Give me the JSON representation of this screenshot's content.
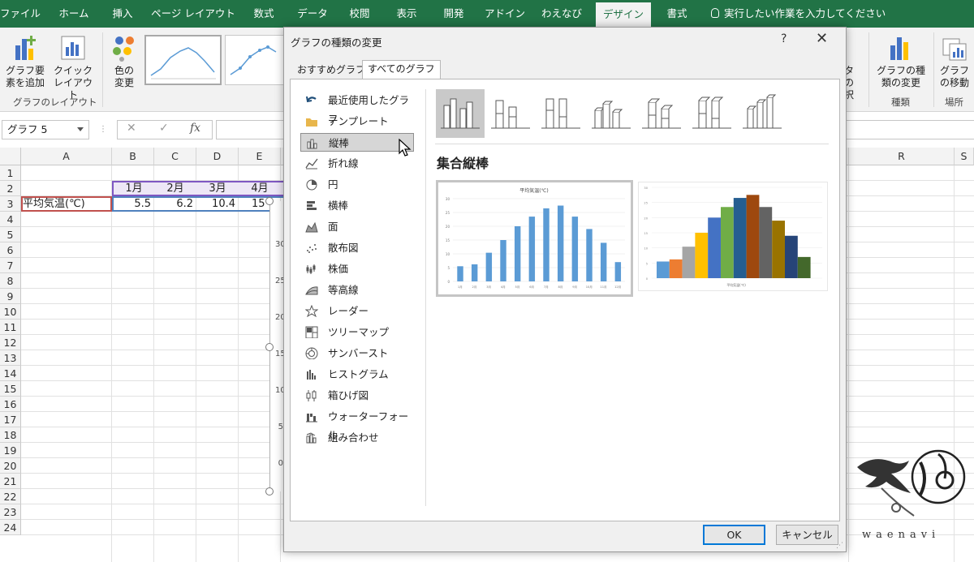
{
  "ribbon": {
    "tabs": [
      "ファイル",
      "ホーム",
      "挿入",
      "ページ レイアウト",
      "数式",
      "データ",
      "校閲",
      "表示",
      "開発",
      "アドイン",
      "わえなび",
      "デザイン",
      "書式"
    ],
    "active_tab": "デザイン",
    "tell_me": "実行したい作業を入力してください",
    "buttons": {
      "add_element": "グラフ要素を追加",
      "quick_layout": "クイックレイアウト",
      "change_color": "色の変更",
      "select_data_partial": "タの択",
      "change_type": "グラフの種類の変更",
      "move_chart": "グラフの移動"
    },
    "group_labels": {
      "layout": "グラフのレイアウト",
      "type": "種類",
      "location": "場所"
    }
  },
  "formula_bar": {
    "name_box": "グラフ 5",
    "fx": "fx"
  },
  "sheet": {
    "columns": [
      "A",
      "B",
      "C",
      "D",
      "E",
      "R",
      "S"
    ],
    "rows": [
      "1",
      "2",
      "3",
      "4",
      "5",
      "6",
      "7",
      "8",
      "9",
      "10",
      "11",
      "12",
      "13",
      "14",
      "15",
      "16",
      "17",
      "18",
      "19",
      "20",
      "21",
      "22",
      "23",
      "24"
    ],
    "months": [
      "1月",
      "2月",
      "3月",
      "4月"
    ],
    "row3_label": "平均気温(℃)",
    "row3_values": [
      "5.5",
      "6.2",
      "10.4",
      "15"
    ],
    "axis_labels": [
      "30",
      "25",
      "20",
      "15",
      "10",
      "5",
      "0"
    ]
  },
  "dialog": {
    "title": "グラフの種類の変更",
    "help": "?",
    "close": "✕",
    "tabs": [
      "おすすめグラフ",
      "すべてのグラフ"
    ],
    "active_tab": "すべてのグラフ",
    "categories": [
      "最近使用したグラフ",
      "テンプレート",
      "縦棒",
      "折れ線",
      "円",
      "横棒",
      "面",
      "散布図",
      "株価",
      "等高線",
      "レーダー",
      "ツリーマップ",
      "サンバースト",
      "ヒストグラム",
      "箱ひげ図",
      "ウォーターフォール",
      "組み合わせ"
    ],
    "selected_category": "縦棒",
    "selected_type_title": "集合縦棒",
    "ok": "OK",
    "cancel": "キャンセル"
  },
  "chart_data": {
    "type": "bar",
    "title": "平均気温(℃)",
    "categories": [
      "1月",
      "2月",
      "3月",
      "4月",
      "5月",
      "6月",
      "7月",
      "8月",
      "9月",
      "10月",
      "11月",
      "12月"
    ],
    "values": [
      5.5,
      6.2,
      10.4,
      15,
      20,
      23.5,
      26.5,
      27.5,
      23.5,
      19,
      14,
      7
    ],
    "ylim": [
      0,
      30
    ],
    "series_color": "#5b9bd5",
    "vary_colors": [
      "#5b9bd5",
      "#ed7d31",
      "#a5a5a5",
      "#ffc000",
      "#4472c4",
      "#70ad47",
      "#255e91",
      "#9e480e",
      "#636363",
      "#997300",
      "#264478",
      "#43682b"
    ],
    "preview2_caption": "平均気温(℃)"
  },
  "watermark": "waenavi",
  "colors": {
    "excel_green": "#217346",
    "selection_purple": "#7e57c2"
  }
}
